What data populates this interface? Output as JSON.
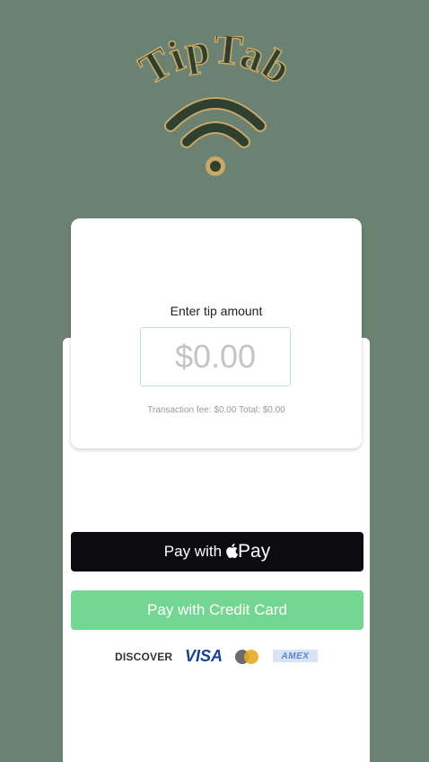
{
  "logo": {
    "text": "TipTab"
  },
  "tip": {
    "label": "Enter tip amount",
    "amount_placeholder": "$0.00",
    "fee_line": "Transaction fee: $0.00  Total: $0.00"
  },
  "buttons": {
    "apple_pay_prefix": "Pay with",
    "apple_pay_brand": "Pay",
    "credit_card": "Pay with Credit Card"
  },
  "card_brands": {
    "discover": "DISCOVER",
    "visa": "VISA",
    "amex": "AMEX"
  },
  "colors": {
    "background": "#6b8272",
    "apple_button": "#0c0c10",
    "card_button": "#74d693",
    "logo_gold": "#c8a868",
    "logo_dark": "#2f3f30"
  }
}
